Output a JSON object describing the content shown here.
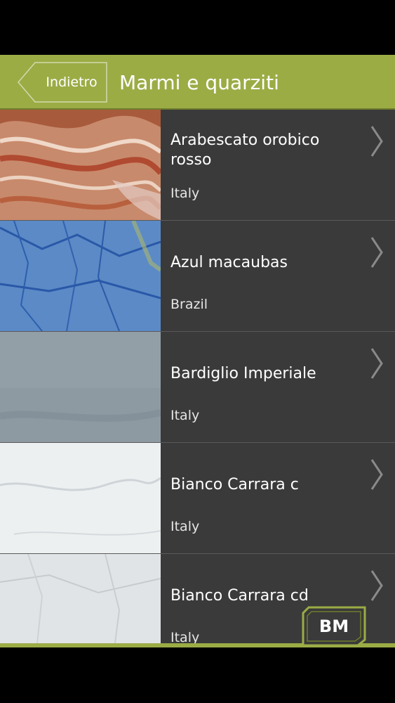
{
  "header": {
    "back_label": "Indietro",
    "title": "Marmi e quarziti"
  },
  "items": [
    {
      "name": "Arabescato orobico rosso",
      "country": "Italy"
    },
    {
      "name": "Azul macaubas",
      "country": "Brazil"
    },
    {
      "name": "Bardiglio Imperiale",
      "country": "Italy"
    },
    {
      "name": "Bianco Carrara c",
      "country": "Italy"
    },
    {
      "name": "Bianco Carrara cd",
      "country": "Italy"
    }
  ],
  "logo": {
    "text": "BM"
  },
  "colors": {
    "accent": "#9bac45",
    "list_bg": "#3a3a3a",
    "divider": "#5a5a5a"
  }
}
